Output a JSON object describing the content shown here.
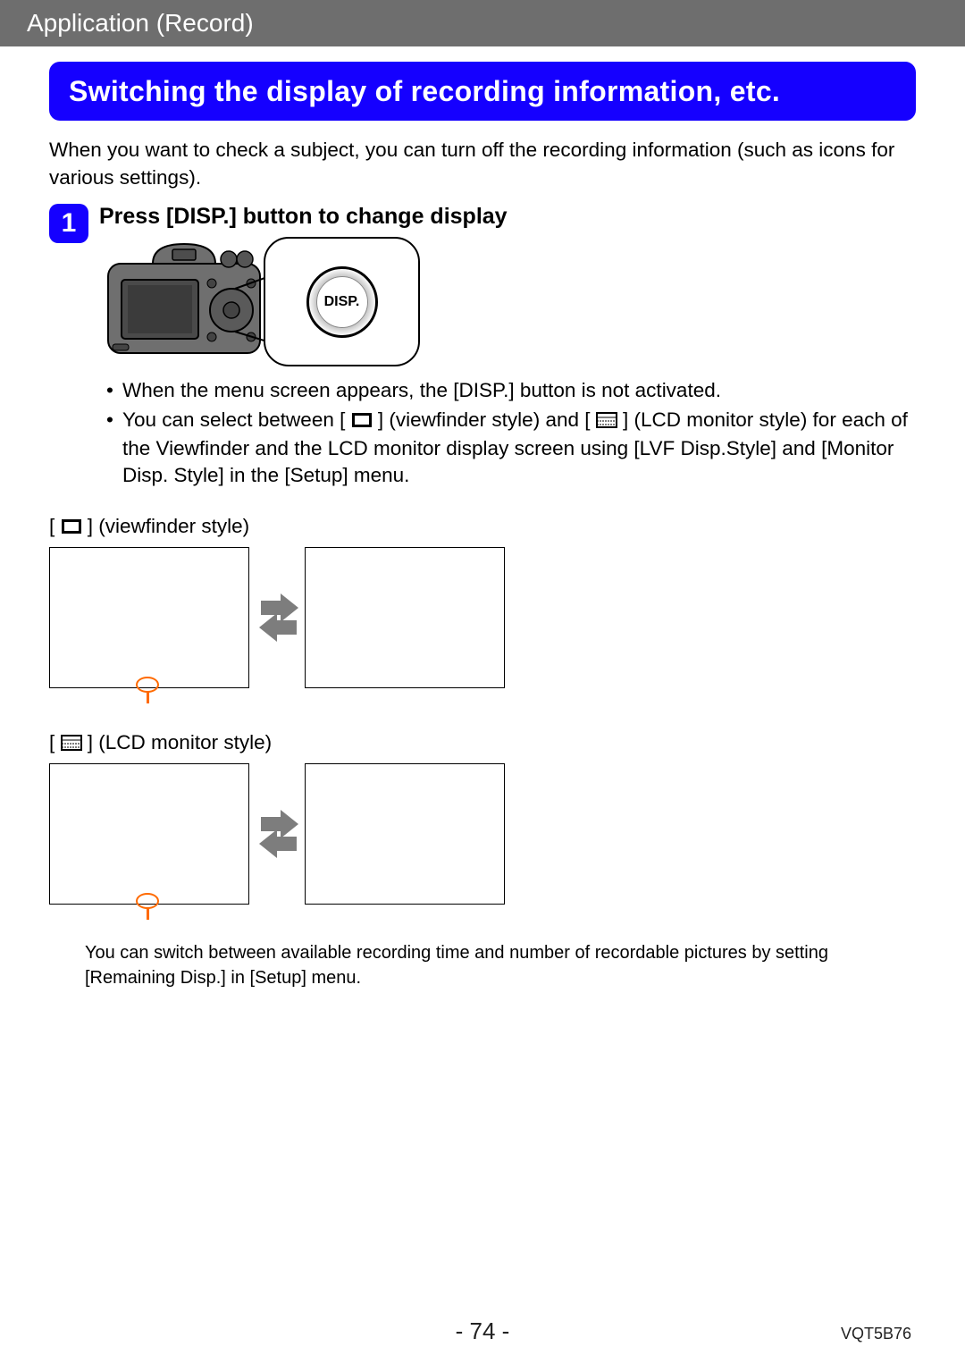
{
  "header": {
    "breadcrumb": "Application (Record)"
  },
  "title": "Switching the display of recording information, etc.",
  "intro": "When you want to check a subject, you can turn off the recording information (such as icons for various settings).",
  "step": {
    "number": "1",
    "title": "Press [DISP.] button to change display",
    "disp_label": "DISP.",
    "bullets": [
      "When the menu screen appears, the [DISP.] button is not activated.",
      "You can select between [",
      "] (viewfinder style) and [",
      "] (LCD monitor style) for each of the Viewfinder and the LCD monitor display screen using [LVF Disp.Style] and [Monitor Disp. Style] in the [Setup] menu."
    ]
  },
  "styles": {
    "viewfinder_prefix": "[",
    "viewfinder_suffix": "] (viewfinder style)",
    "lcd_prefix": "[",
    "lcd_suffix": "] (LCD monitor style)"
  },
  "note": "You can switch between available recording time and number of recordable pictures by setting [Remaining Disp.] in [Setup] menu.",
  "footer": {
    "page": "- 74 -",
    "doc_code": "VQT5B76"
  }
}
